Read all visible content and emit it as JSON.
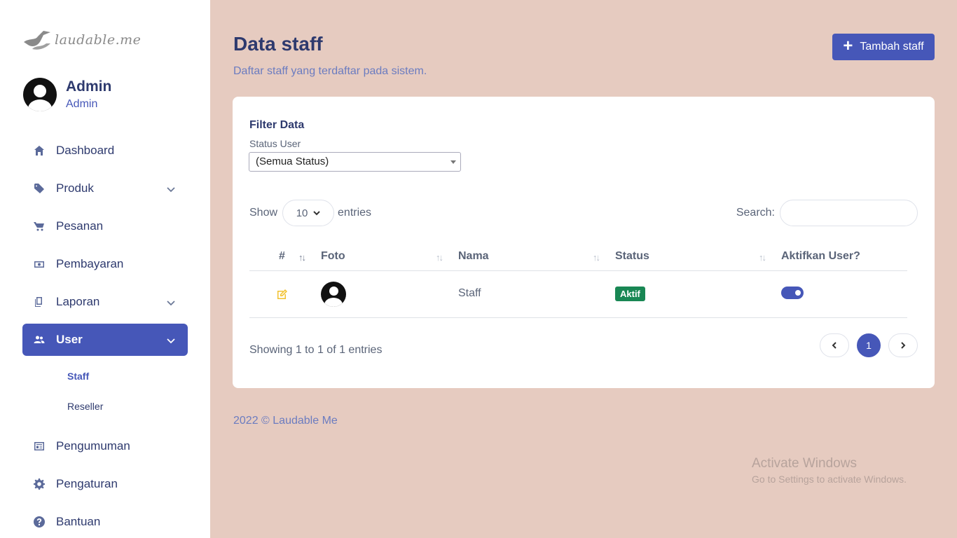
{
  "brand": {
    "logo_text": "laudable.me"
  },
  "profile": {
    "name": "Admin",
    "role": "Admin"
  },
  "sidebar": {
    "items": [
      {
        "label": "Dashboard",
        "icon": "home-icon"
      },
      {
        "label": "Produk",
        "icon": "tag-icon",
        "expandable": true
      },
      {
        "label": "Pesanan",
        "icon": "cart-icon"
      },
      {
        "label": "Pembayaran",
        "icon": "money-icon"
      },
      {
        "label": "Laporan",
        "icon": "document-icon",
        "expandable": true
      },
      {
        "label": "User",
        "icon": "users-icon",
        "expandable": true,
        "active": true
      },
      {
        "label": "Pengumuman",
        "icon": "newspaper-icon"
      },
      {
        "label": "Pengaturan",
        "icon": "gear-icon"
      },
      {
        "label": "Bantuan",
        "icon": "help-icon"
      }
    ],
    "user_sub": [
      {
        "label": "Staff",
        "active": true
      },
      {
        "label": "Reseller"
      }
    ]
  },
  "header": {
    "title": "Data staff",
    "subtitle": "Daftar staff yang terdaftar pada sistem.",
    "add_button": "Tambah staff"
  },
  "filter": {
    "title": "Filter Data",
    "label": "Status User",
    "selected": "(Semua Status)"
  },
  "table_controls": {
    "show": "Show",
    "length": "10",
    "entries": "entries",
    "search_label": "Search:",
    "search_value": ""
  },
  "table": {
    "columns": [
      "#",
      "Foto",
      "Nama",
      "Status",
      "Aktifkan User?"
    ],
    "rows": [
      {
        "name": "Staff",
        "status": "Aktif",
        "active_toggle": true
      }
    ]
  },
  "pagination": {
    "info": "Showing 1 to 1 of 1 entries",
    "current_page": "1"
  },
  "footer": {
    "text": "2022 © Laudable Me"
  },
  "watermark": {
    "line1": "Activate Windows",
    "line2": "Go to Settings to activate Windows."
  },
  "colors": {
    "accent": "#4657b8",
    "background": "#e6cbc0",
    "status_active": "#198754",
    "edit_icon": "#f2c230"
  }
}
